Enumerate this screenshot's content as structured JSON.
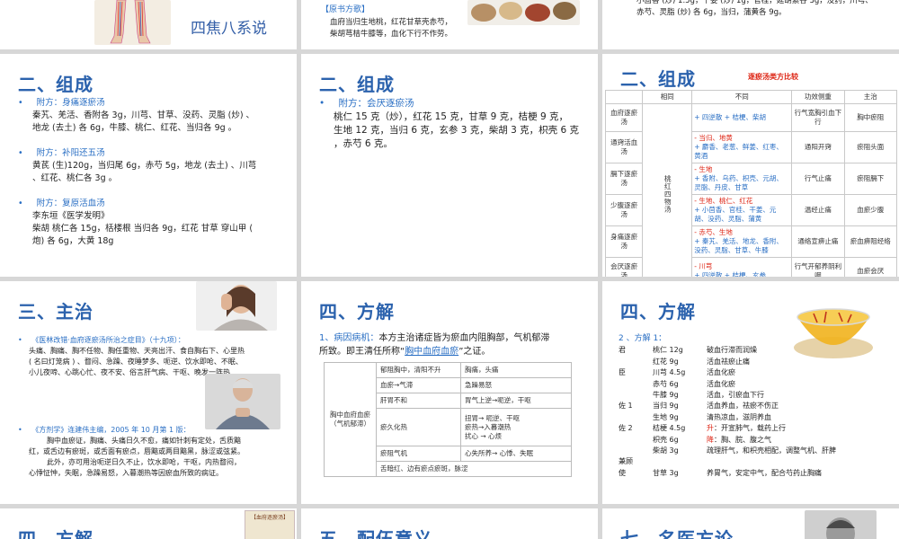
{
  "row0": {
    "s1": {
      "title": "四焦八系说"
    },
    "s2": {
      "label": "【原书方歌】",
      "lines": [
        "血府当归生地桃，红花甘草壳赤芍，",
        "柴胡芎桔牛膝等，血化下行不作劳。"
      ]
    },
    "s3": {
      "lines": [
        "小茴香 (炒) 1.5g，干姜 (炒) 1g，官桂，延胡索各 3g，没药，川芎、",
        "赤芍、灵脂 (炒) 各 6g，当归，蒲黄各 9g。"
      ]
    }
  },
  "s4": {
    "title": "二、组成",
    "items": [
      {
        "head": "附方：身痛逐瘀汤",
        "body": [
          "秦艽、羌活、香附各 3g，川芎、甘草、没药、灵脂 (炒) 、",
          "地龙 (去土) 各 6g，牛膝、桃仁、红花、当归各 9g 。"
        ]
      },
      {
        "head": "附方：补阳还五汤",
        "body": [
          "黄芪 (生)120g，当归尾 6g，赤芍 5g，地龙 (去土) 、川芎",
          "、红花、桃仁各 3g 。"
        ]
      },
      {
        "head": "附方：复原活血汤",
        "body": [
          "李东垣《医学发明》",
          "柴胡 桃仁各 15g，栝楼根 当归各 9g，红花 甘草 穿山甲 (",
          "炮) 各 6g，大黄 18g"
        ]
      }
    ]
  },
  "s5": {
    "title": "二、组成",
    "head": "附方：会厌逐瘀汤",
    "body": [
      "桃仁 15 克（炒），红花 15 克，甘草 9 克，桔梗 9 克，",
      "生地 12 克，当归 6 克，玄参 3 克，柴胡 3 克，枳壳 6 克",
      "，赤芍 6 克。"
    ]
  },
  "s6": {
    "title": "二、组成",
    "subtitle": "逐瘀汤类方比较",
    "headers": [
      "",
      "相同",
      "不同",
      "功效侧重",
      "主治"
    ],
    "common": "桃红四物汤",
    "rows": [
      {
        "name": "血府逐瘀汤",
        "diff": [
          {
            "s": "+",
            "t": "四逆散 + 桔梗、柴胡"
          }
        ],
        "effect": "行气宽胸引血下行",
        "main": "胸中瘀阻"
      },
      {
        "name": "通窍活血汤",
        "diff": [
          {
            "s": "-",
            "t": "当归、地黄"
          },
          {
            "s": "+",
            "t": "麝香、老葱、鲜姜、红枣、黄酒"
          }
        ],
        "effect": "通阳开窍",
        "main": "瘀阻头面"
      },
      {
        "name": "膈下逐瘀汤",
        "diff": [
          {
            "s": "-",
            "t": "生地"
          },
          {
            "s": "+",
            "t": "香附、乌药、枳壳、元胡、灵脂、丹皮、甘草"
          }
        ],
        "effect": "行气止痛",
        "main": "瘀阻膈下"
      },
      {
        "name": "少腹逐瘀汤",
        "diff": [
          {
            "s": "-",
            "t": "生地、桃仁、红花"
          },
          {
            "s": "+",
            "t": "小茴香、官桂、干姜、元胡、没药、灵脂、蒲黄"
          }
        ],
        "effect": "温经止痛",
        "main": "血瘀少腹"
      },
      {
        "name": "身痛逐瘀汤",
        "diff": [
          {
            "s": "-",
            "t": "赤芍、生地"
          },
          {
            "s": "+",
            "t": "秦艽、羌活、地龙、香附、没药、灵脂、甘草、牛膝"
          }
        ],
        "effect": "通络宣痹止痛",
        "main": "瘀血痹阻经络"
      },
      {
        "name": "会厌逐瘀汤",
        "diff": [
          {
            "s": "-",
            "t": "川芎"
          },
          {
            "s": "+",
            "t": "四逆散 + 桔梗、玄参"
          }
        ],
        "effect": "行气开郁养阴利咽",
        "main": "血瘀会厌"
      }
    ]
  },
  "s7": {
    "title": "三、主治",
    "p1head": "《医林改错·血府逐瘀汤所治之症目》（十九项）：",
    "p1": [
      "头痛、胸痛、胸不任物、胸任重物、天亮出汗、食自胸右下、心里热",
      "( 名曰灯笼病 ) 、瞀闷、急躁、夜睡梦多、呃逆、饮水即呛、不眠、",
      "小儿夜啼、心跳心忙、夜不安、俗言肝气病、干呕、晚发一阵热"
    ],
    "p2head": "《方剂学》连建伟主编，2005 年 10 月第 1 版：",
    "p2": [
      "胸中血瘀证，胸痛、头痛日久不愈，痛如针刺有定处，舌质黯",
      "红，或舌边有瘀斑，或舌面有瘀点，唇黯或两目黯黑，脉涩或弦紧。",
      "此外，亦可用治呃逆日久不止，饮水即呛，干呕，内热瞀闷，",
      "心悸怔忡，失眠，急躁易怒，入暮潮热等因瘀血所致的病证。"
    ]
  },
  "s8": {
    "title": "四、方解",
    "intro": [
      "1、病因病机：本方主治诸症皆为瘀血内阻胸部，气机郁滞",
      "所致。即王清任所称“胸中血府血瘀”之证。"
    ],
    "introSeq": [
      "1、病因病机：",
      "本方主治诸症皆为瘀血内阻胸部，气机郁滞",
      "所致。即王清任所称“",
      "胸中血府血瘀",
      "”之证。"
    ],
    "root": "胸中血府血瘀（气机郁滞）",
    "rows": [
      {
        "a": "郁阻胸中，清阳不升",
        "b": "胸痛，头痛"
      },
      {
        "a": "血瘀→气滞",
        "b": "急躁易怒"
      },
      {
        "a": "肝胃不和",
        "b": "胃气上逆→呃逆，干呕"
      },
      {
        "a": "瘀久化热",
        "b": "扭胃→ 呃逆、干呕\n瘀热→入暮潮热\n扰心 → 心烦"
      },
      {
        "a": "瘀阻气机",
        "b": "心失所养→ 心悸、失眠"
      },
      {
        "a": "舌暗红、边有瘀点瘀斑，脉涩",
        "b": ""
      }
    ]
  },
  "s9": {
    "title": "四、方解",
    "head": "2 、方解 1：",
    "rows": [
      {
        "role": "君",
        "herb": "桃仁 12g",
        "note": "破血行滞而润燥"
      },
      {
        "role": "",
        "herb": "红花 9g",
        "note": "活血祛瘀止痛"
      },
      {
        "role": "臣",
        "herb": "川芎 4.5g",
        "note": "活血化瘀"
      },
      {
        "role": "",
        "herb": "赤芍 6g",
        "note": "活血化瘀"
      },
      {
        "role": "",
        "herb": "牛膝 9g",
        "note": "活血，引瘀血下行"
      },
      {
        "role": "佐 1",
        "herb": "当归 9g",
        "note": "活血养血，祛瘀不伤正"
      },
      {
        "role": "",
        "herb": "生地 9g",
        "note": "清热凉血，滋阴养血"
      },
      {
        "role": "佐 2",
        "herb": "桔梗 4.5g",
        "mark": "升",
        "note": "：开宣肺气，载药上行"
      },
      {
        "role": "",
        "herb": "枳壳 6g",
        "mark": "降",
        "note": "：胸、脘、腹之气"
      },
      {
        "role": "",
        "herb": "柴胡 3g",
        "note": "疏理肝气，和枳壳相配，调整气机、肝脾"
      },
      {
        "role": "兼顾",
        "herb": "",
        "note": ""
      },
      {
        "role": "使",
        "herb": "甘草 3g",
        "note": "养胃气，安定中气，配合芍药止胸痛"
      }
    ]
  },
  "row3": {
    "s1": {
      "title": "四、方解",
      "stamp": "【血府逐瘀汤】"
    },
    "s2": {
      "title": "五、配伍意义"
    },
    "s3": {
      "title": "七、名医方论"
    }
  },
  "colors": {
    "accent": "#2b62ad",
    "red": "#d21",
    "bg": "#d7d7d7"
  }
}
